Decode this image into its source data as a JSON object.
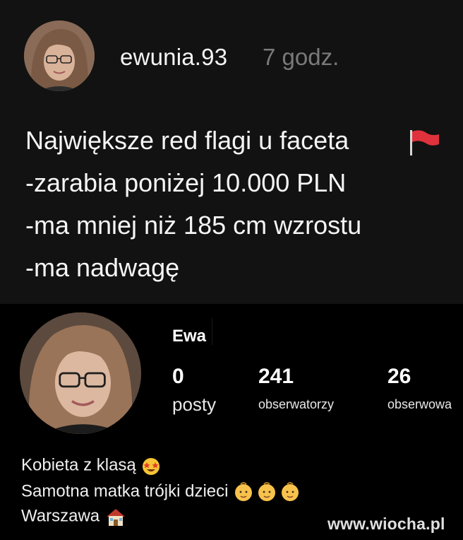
{
  "post": {
    "username": "ewunia.93",
    "time": "7 godz.",
    "lines": [
      "Największe red flagi u faceta",
      "-zarabia poniżej 10.000 PLN",
      "-ma mniej niż 185 cm wzrostu",
      "-ma nadwagę"
    ],
    "flag_icon": "red-flag-icon"
  },
  "profile": {
    "display_name": "Ewa",
    "stats": [
      {
        "value": "0",
        "label": "posty"
      },
      {
        "value": "241",
        "label": "obserwatorzy"
      },
      {
        "value": "26",
        "label": "obserwowa"
      }
    ],
    "bio": [
      {
        "text": "Kobieta z klasą",
        "icon": "star-struck-emoji-icon"
      },
      {
        "text": "Samotna matka trójki dzieci",
        "icon": "baby-emoji-icon"
      },
      {
        "text": "Warszawa",
        "icon": "house-emoji-icon"
      }
    ]
  },
  "watermark": "www.wiocha.pl",
  "colors": {
    "post_bg": "#121212",
    "profile_bg": "#000000",
    "time_gray": "#7a7a7a",
    "flag_red": "#e0323c"
  }
}
